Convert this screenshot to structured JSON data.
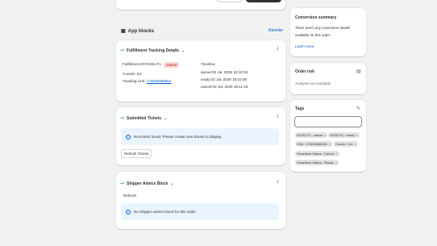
{
  "app_blocks": {
    "title": "App blocks",
    "reorder": "Reorder"
  },
  "fulfillment": {
    "title": "Fulfillment Tracking Details",
    "id_label": "Fulfillment ID:",
    "id_value": "#1031-F1",
    "status_badge": "cancel",
    "courier": "Courier: tcs",
    "tracking_label": "Tracking Link:",
    "tracking_value": "173005365051",
    "timeline_title": "Timeline:",
    "timeline": [
      "queue:02 Jul, 2025 18:10:33",
      "ready:02 Jul, 2025 18:10:38",
      "cancel:02 Jul, 2025 18:11:16"
    ]
  },
  "tickets": {
    "title": "Submitted Tickets",
    "message": "No tickets found. Please create new tickets to display.",
    "refresh": "Refresh Tickets"
  },
  "shipper": {
    "title": "Shipper Advice Block",
    "refresh": "Refresh",
    "message": "No shipper advice found for this order."
  },
  "conversion": {
    "title": "Conversion summary",
    "text1": "There aren't any conversion details",
    "text2": "available for this order.",
    "learn_more": "Learn more"
  },
  "risk": {
    "title": "Order risk",
    "text": "Analysis not available"
  },
  "tags": {
    "title": "Tags",
    "items": [
      "#1031-F1 : cancel",
      "#1031-F1 : ready",
      "CN# : 173005365051",
      "Courier : tcs",
      "Smartlane Status : Cancel",
      "Smartlane Status : Ready"
    ]
  }
}
